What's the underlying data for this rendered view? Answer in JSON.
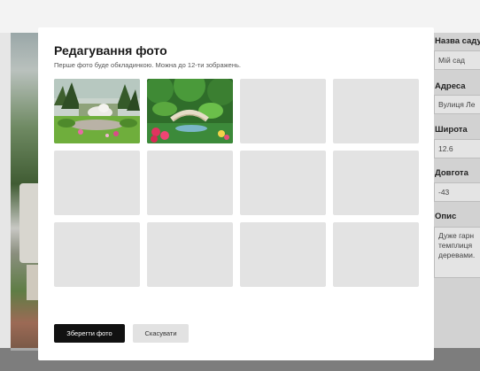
{
  "modal": {
    "title": "Редагування фото",
    "subtitle": "Перше фото буде обкладинкою. Можна до 12-ти зображень.",
    "save_label": "Зберегти фото",
    "cancel_label": "Скасувати",
    "slots": [
      {
        "state": "photo"
      },
      {
        "state": "photo"
      },
      {
        "state": "empty"
      },
      {
        "state": "empty"
      },
      {
        "state": "empty"
      },
      {
        "state": "empty"
      },
      {
        "state": "empty"
      },
      {
        "state": "empty"
      },
      {
        "state": "empty"
      },
      {
        "state": "empty"
      },
      {
        "state": "empty"
      },
      {
        "state": "empty"
      }
    ]
  },
  "form": {
    "name_label": "Назва саду",
    "name_value": "Мій сад",
    "address_label": "Адреса",
    "address_value": "Вулиця Ле",
    "lat_label": "Широта",
    "lat_value": "12.6",
    "lon_label": "Довгота",
    "lon_value": "-43",
    "desc_label": "Опис",
    "desc_value": "Дуже гарн темплиця деревами."
  },
  "colors": {
    "overlay": "#8a8a8a",
    "save_button": "#111111",
    "cancel_button": "#e2e2e2",
    "empty_slot": "#e3e3e3"
  }
}
